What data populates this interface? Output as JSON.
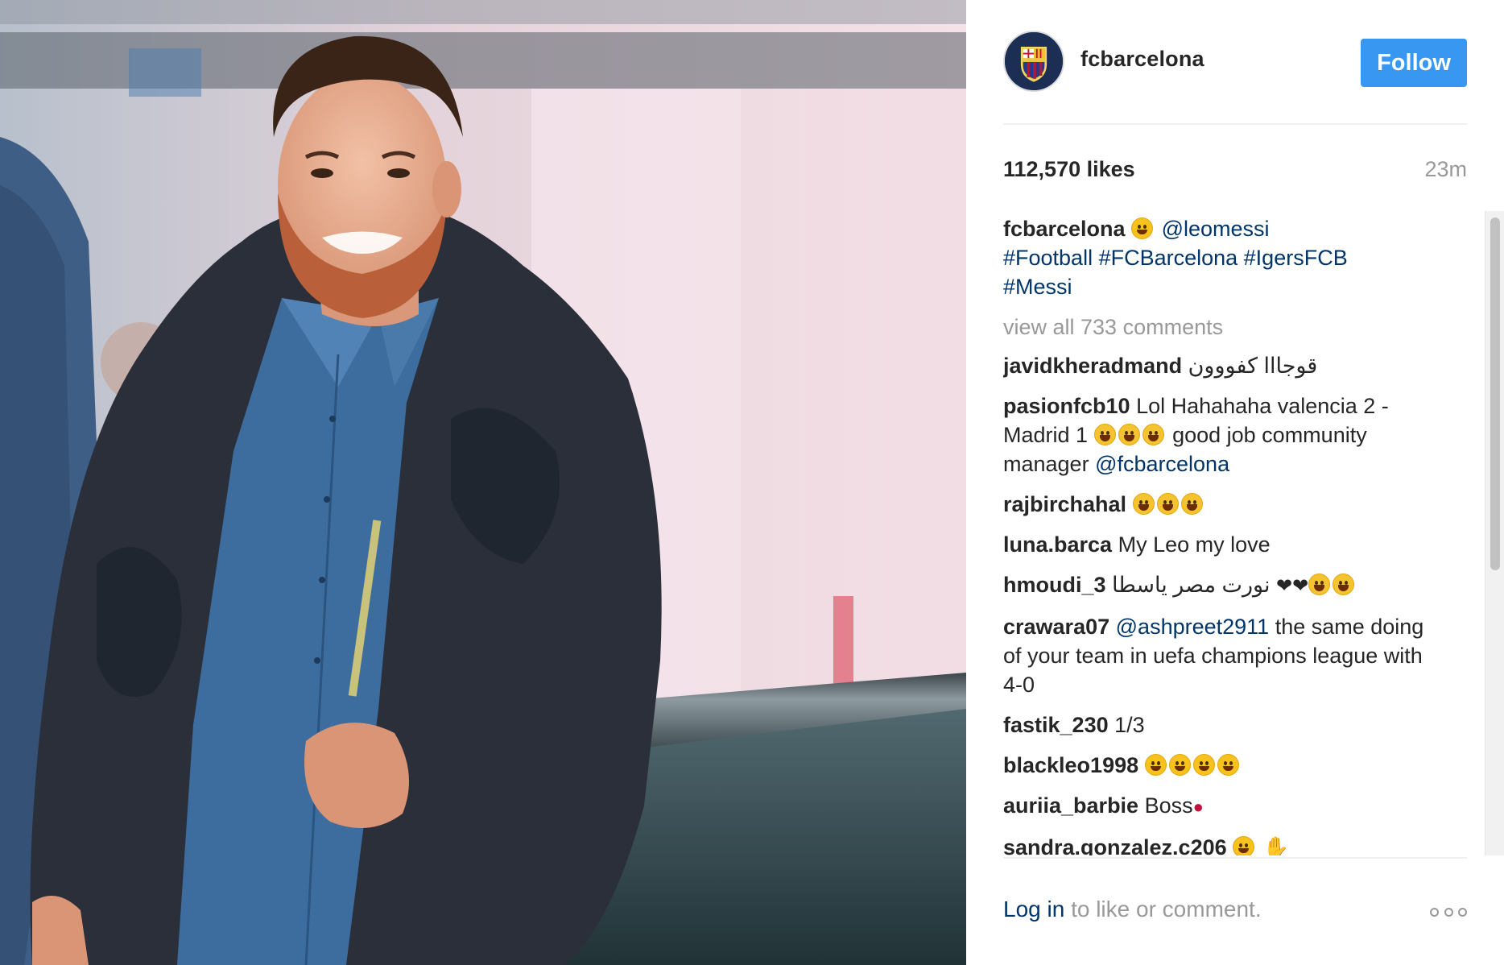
{
  "post": {
    "username": "fcbarcelona",
    "follow_label": "Follow",
    "likes": "112,570 likes",
    "time_ago": "23m"
  },
  "caption": {
    "user": "fcbarcelona",
    "mention": "@leomessi",
    "tags_line1": "#Football #FCBarcelona #IgersFCB",
    "tags_line2": "#Messi"
  },
  "view_all": "view all 733 comments",
  "comments": [
    {
      "user": "javidkheradmand",
      "text": "قوجااا کفووون"
    },
    {
      "user": "pasionfcb10",
      "text1": "Lol Hahahaha valencia 2 - Madrid 1",
      "text2": "good job community manager",
      "mention": "@fcbarcelona"
    },
    {
      "user": "rajbirchahal"
    },
    {
      "user": "luna.barca",
      "text": "My Leo my love"
    },
    {
      "user": "hmoudi_3",
      "text": "نورت مصر ياسطا"
    },
    {
      "user": "crawara07",
      "mention": "@ashpreet2911",
      "text": "the same doing of your team in uefa champions league with 4-0"
    },
    {
      "user": "fastik_230",
      "text": "1/3"
    },
    {
      "user": "blackleo1998"
    },
    {
      "user": "auriia_barbie",
      "text": "Boss"
    },
    {
      "user": "sandra.gonzalez.c206"
    }
  ],
  "footer": {
    "login": "Log in",
    "rest": "to like or comment."
  },
  "colors": {
    "follow_button": "#3897f0",
    "link": "#003569",
    "muted": "#999999"
  }
}
